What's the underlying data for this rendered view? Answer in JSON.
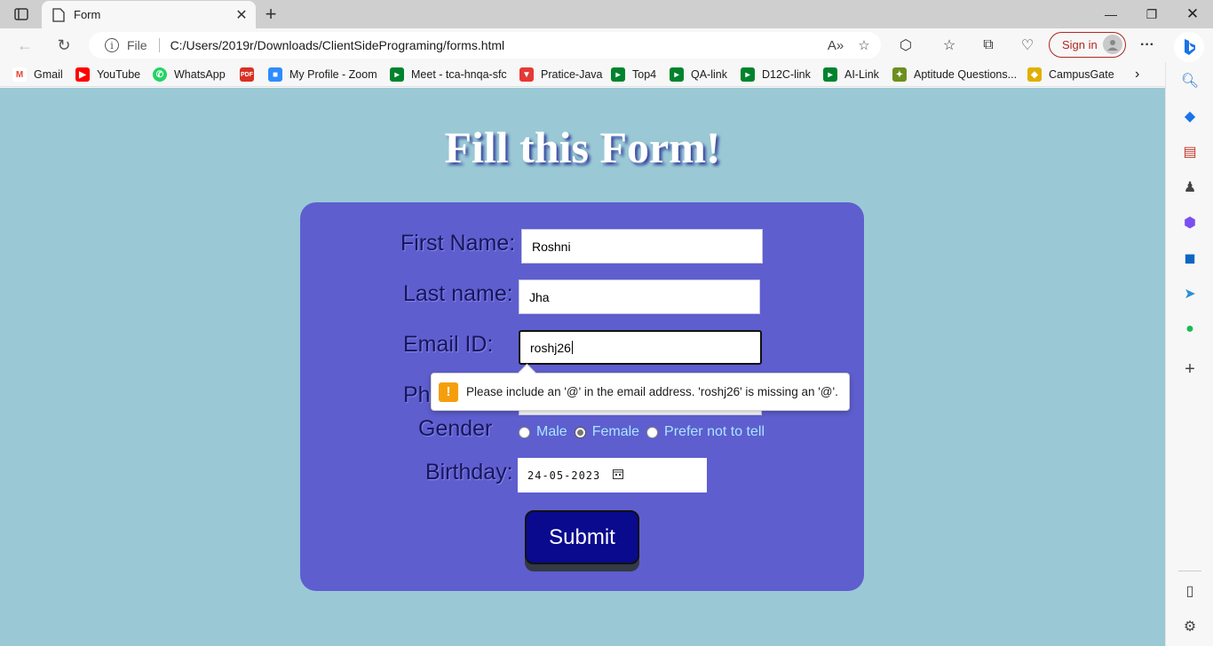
{
  "browser": {
    "tab_title": "Form",
    "url_scheme": "File",
    "url": "C:/Users/2019r/Downloads/ClientSidePrograming/forms.html",
    "sign_in": "Sign in"
  },
  "bookmarks": [
    {
      "label": "Gmail",
      "color": "#ea4335"
    },
    {
      "label": "YouTube",
      "color": "#ff0000"
    },
    {
      "label": "WhatsApp",
      "color": "#25d366"
    },
    {
      "label": "",
      "color": "#d93025"
    },
    {
      "label": "My Profile - Zoom",
      "color": "#2d8cff"
    },
    {
      "label": "Meet - tca-hnqa-sfc",
      "color": "#00832d"
    },
    {
      "label": "Pratice-Java",
      "color": "#e53935"
    },
    {
      "label": "Top4",
      "color": "#00832d"
    },
    {
      "label": "QA-link",
      "color": "#00832d"
    },
    {
      "label": "D12C-link",
      "color": "#00832d"
    },
    {
      "label": "AI-Link",
      "color": "#00832d"
    },
    {
      "label": "Aptitude Questions...",
      "color": "#6d8f1f"
    },
    {
      "label": "CampusGate",
      "color": "#e0b000"
    }
  ],
  "page": {
    "title": "Fill this Form!",
    "background": "#9ac9d5",
    "card_color": "#5e5ecf"
  },
  "form": {
    "first_name_label": "First Name:",
    "first_name_value": "Roshni",
    "last_name_label": "Last name:",
    "last_name_value": "Jha",
    "email_label": "Email ID:",
    "email_value": "roshj26",
    "phone_label_visible": "Ph",
    "gender_label": "Gender",
    "gender_options": [
      "Male",
      "Female",
      "Prefer not to tell"
    ],
    "gender_selected": "Female",
    "birthday_label": "Birthday:",
    "birthday_value": "24-05-2023",
    "submit_label": "Submit"
  },
  "tooltip": {
    "message": "Please include an '@' in the email address. 'roshj26' is missing an '@'.",
    "icon": "warning-icon"
  }
}
